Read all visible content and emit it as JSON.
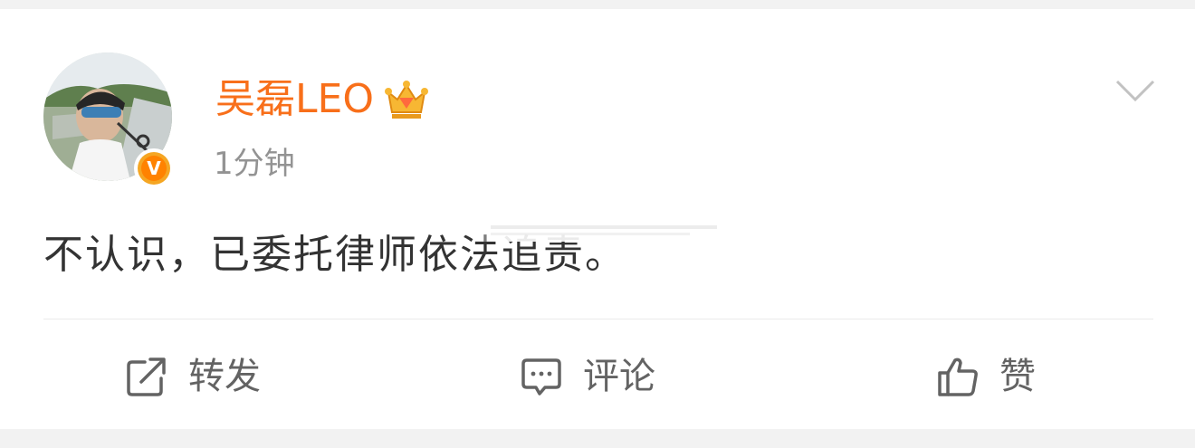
{
  "post": {
    "author": {
      "name": "吴磊LEO"
    },
    "timestamp": "1分钟",
    "content": "不认识，已委托律师依法追责。",
    "verified_badge": "V"
  },
  "actions": {
    "repost_label": "转发",
    "comment_label": "评论",
    "like_label": "赞"
  },
  "icons": {
    "more": "chevron-down-icon",
    "repost": "share-icon",
    "comment": "comment-icon",
    "like": "thumbs-up-icon",
    "member": "crown-icon"
  },
  "colors": {
    "username": "#f86f1a",
    "verified": "#ff8200",
    "text": "#333333",
    "muted": "#939393",
    "action": "#636363",
    "background": "#f2f2f2"
  }
}
